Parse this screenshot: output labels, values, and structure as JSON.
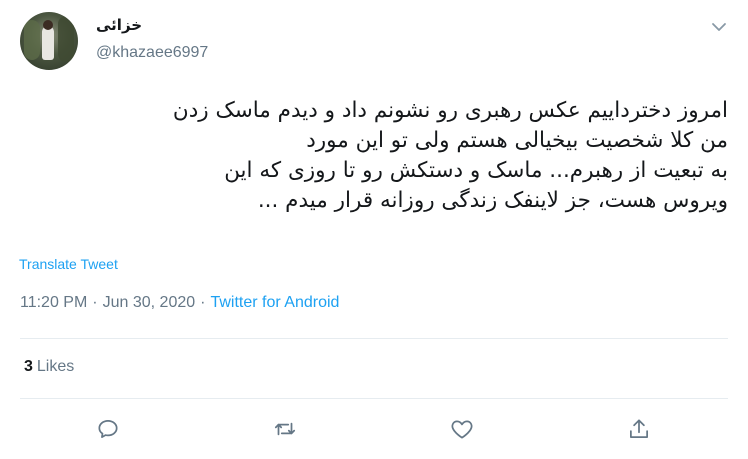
{
  "author": {
    "name": "خزائی",
    "handle": "@khazaee6997"
  },
  "tweet": {
    "lines": [
      "امروز دخترداییم عکس رهبری رو نشونم داد و دیدم ماسک زدن",
      "من کلا شخصیت بیخیالی هستم ولی تو این مورد",
      "به تبعیت از رهبرم... ماسک و دستکش رو تا روزی که این",
      "ویروس هست، جز لاینفک زندگی روزانه قرار میدم ..."
    ],
    "translate_label": "Translate Tweet"
  },
  "meta": {
    "time": "11:20 PM",
    "separator": "·",
    "date": "Jun 30, 2020",
    "source": "Twitter for Android"
  },
  "stats": {
    "likes_count": "3",
    "likes_label": "Likes"
  },
  "icons": {
    "menu": "chevron-down-icon",
    "reply": "reply-icon",
    "retweet": "retweet-icon",
    "like": "heart-icon",
    "share": "share-icon"
  },
  "colors": {
    "accent": "#1da1f2",
    "secondary_text": "#657786",
    "primary_text": "#14171a",
    "divider": "#e6ecf0"
  }
}
